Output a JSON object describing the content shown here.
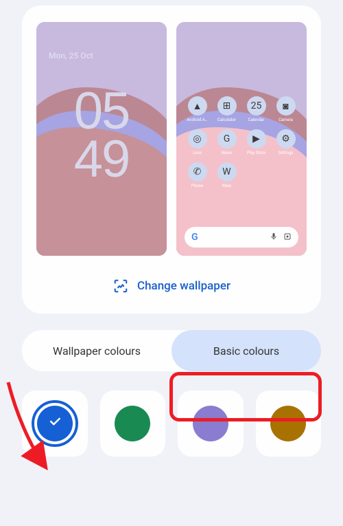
{
  "preview": {
    "lock": {
      "date": "Mon, 25 Oct",
      "hour": "05",
      "minute": "49"
    },
    "home": {
      "apps": [
        {
          "label": "Android A…",
          "glyph": "▲"
        },
        {
          "label": "Calculator",
          "glyph": "⊞"
        },
        {
          "label": "Calendar",
          "glyph": "25"
        },
        {
          "label": "Camera",
          "glyph": "◙"
        },
        {
          "label": "Lens",
          "glyph": "◎"
        },
        {
          "label": "News",
          "glyph": "G"
        },
        {
          "label": "Play Store",
          "glyph": "▶"
        },
        {
          "label": "Settings",
          "glyph": "⚙"
        },
        {
          "label": "Phone",
          "glyph": "✆"
        },
        {
          "label": "Wear",
          "glyph": "W"
        },
        {
          "label": "",
          "glyph": ""
        },
        {
          "label": "",
          "glyph": ""
        }
      ],
      "search_g": "G"
    }
  },
  "change_wallpaper_label": "Change wallpaper",
  "tabs": {
    "wallpaper": "Wallpaper colours",
    "basic": "Basic colours"
  },
  "swatches": [
    {
      "color": "#1560d4",
      "selected": true
    },
    {
      "color": "#1a8a53",
      "selected": false
    },
    {
      "color": "#8a7cd0",
      "selected": false
    },
    {
      "color": "#a87200",
      "selected": false
    }
  ],
  "annotation": {
    "highlight_target": "tab-basic-colours",
    "arrow_target": "swatch-blue"
  }
}
